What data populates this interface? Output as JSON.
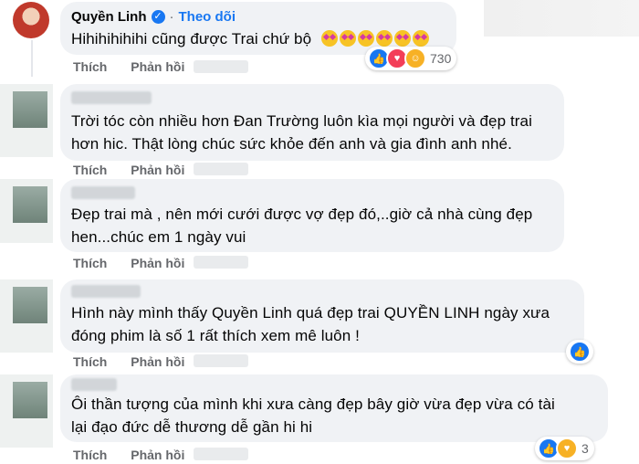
{
  "main_comment": {
    "author": "Quyền Linh",
    "verified_icon": "verified-badge-icon",
    "follow_label": "Theo dõi",
    "text": "Hihihihihihi cũng được Trai chứ bộ",
    "emoji_icon": "star-struck-emoji-icon",
    "emoji_count": 6,
    "like_label": "Thích",
    "reply_label": "Phản hồi",
    "reaction_count": "730",
    "reaction_icons": [
      "like-icon",
      "love-icon",
      "haha-icon"
    ]
  },
  "replies": [
    {
      "text_line1": "Trời tóc còn nhiều hơn Đan Trường luôn kìa mọi người và đẹp trai",
      "text_line2": "hơn hic. Thật lòng chúc sức khỏe đến anh và gia đình anh nhé.",
      "like_label": "Thích",
      "reply_label": "Phản hồi"
    },
    {
      "text_line1": "Đẹp trai mà , nên mới cưới được vợ đẹp đó,..giờ cả nhà cùng đẹp",
      "text_line2": "hen...chúc em 1 ngày vui",
      "like_label": "Thích",
      "reply_label": "Phản hồi"
    },
    {
      "text_line1": "Hình này mình thấy Quyền Linh quá đẹp trai QUYỀN LINH ngày xưa",
      "text_line2": "đóng phim là số 1 rất thích xem mê luôn !",
      "like_label": "Thích",
      "reply_label": "Phản hồi",
      "reaction_icons": [
        "like-icon"
      ]
    },
    {
      "text_line1": "Ôi thần tượng của mình khi xưa càng đẹp bây giờ vừa đẹp vừa có tài",
      "text_line2": "lại đạo đức dễ thương dễ gần hi hi",
      "like_label": "Thích",
      "reply_label": "Phản hồi",
      "reaction_count": "3",
      "reaction_icons": [
        "like-icon",
        "care-icon"
      ]
    }
  ],
  "colors": {
    "bubble": "#f0f2f5",
    "link_blue": "#1877f2",
    "action_gray": "#65676b",
    "text": "#050505"
  }
}
